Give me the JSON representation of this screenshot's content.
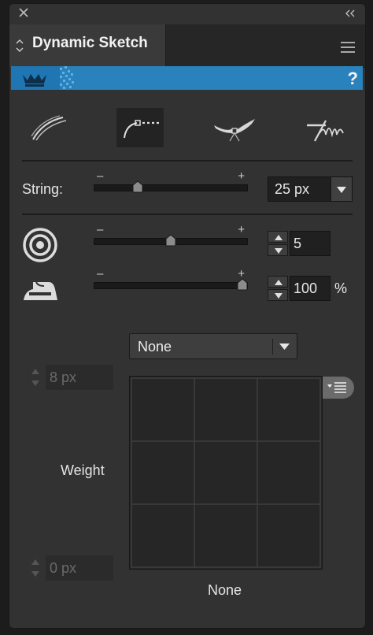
{
  "window": {
    "close_icon": "close-icon",
    "collapse_icon": "double-chevron-left-icon"
  },
  "tab": {
    "title": "Dynamic Sketch",
    "reorder_icon": "up-down-chevron-icon",
    "menu_icon": "hamburger-menu-icon"
  },
  "banner": {
    "crown_icon": "crown-icon",
    "help_label": "?",
    "color": "#2a82bd"
  },
  "modes": [
    {
      "name": "stroke-mode",
      "icon": "multi-stroke-icon",
      "active": false
    },
    {
      "name": "string-mode",
      "icon": "string-curve-icon",
      "active": true
    },
    {
      "name": "ribbon-mode",
      "icon": "ribbon-icon",
      "active": false
    },
    {
      "name": "scribble-mode",
      "icon": "scribble-icon",
      "active": false
    }
  ],
  "string": {
    "label": "String:",
    "minus": "–",
    "plus": "+",
    "slider_fraction": 0.27,
    "value": "25 px"
  },
  "rings": {
    "icon": "target-rings-icon",
    "minus": "–",
    "plus": "+",
    "slider_fraction": 0.5,
    "value": "5"
  },
  "iron": {
    "icon": "iron-icon",
    "minus": "–",
    "plus": "+",
    "slider_fraction": 1.0,
    "value": "100",
    "unit": "%"
  },
  "profile": {
    "dropdown_value": "None",
    "top_value": "8 px",
    "bottom_value": "0 px",
    "weight_label": "Weight",
    "bottom_label": "None",
    "pill_icon": "list-menu-icon"
  }
}
